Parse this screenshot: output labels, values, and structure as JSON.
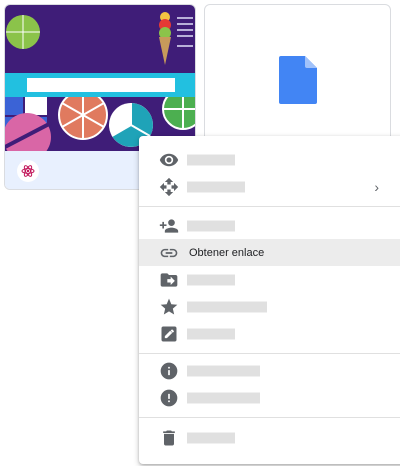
{
  "menu": {
    "get_link_label": "Obtener enlace",
    "submenu_arrow": "›"
  },
  "icons": {
    "preview": "eye-icon",
    "move": "move-arrows-icon",
    "share": "add-person-icon",
    "get_link": "link-icon",
    "move_to": "folder-move-icon",
    "star": "star-icon",
    "rename": "edit-icon",
    "details": "info-icon",
    "report": "exclamation-icon",
    "remove": "trash-icon"
  },
  "colors": {
    "doc_icon": "#4285f4",
    "icon_gray": "#5f6368",
    "highlight": "#ececec"
  }
}
